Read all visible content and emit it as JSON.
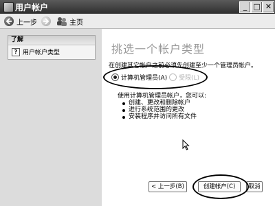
{
  "window": {
    "title": "用户帐户",
    "controls": {
      "minimize": "_",
      "maximize": "□",
      "close": "✕"
    }
  },
  "nav": {
    "back_label": "上一步",
    "home_label": "主页"
  },
  "sidebar": {
    "section_title": "了解",
    "items": [
      {
        "label": "用户帐户类型",
        "icon": "help-icon"
      }
    ]
  },
  "main": {
    "title": "挑选一个帐户类型",
    "instruction": "在创建其它帐户之前必须先创建至少一个管理员帐户。",
    "options": [
      {
        "label": "计算机管理员(A)",
        "selected": true,
        "enabled": true
      },
      {
        "label": "受限(L)",
        "selected": false,
        "enabled": false
      }
    ],
    "description_title": "使用计算机管理员帐户，您可以:",
    "description_items": [
      "创建、更改和删除帐户",
      "进行系统范围的更改",
      "安装程序并访问所有文件"
    ]
  },
  "buttons": {
    "back": "< 上一步(B)",
    "create": "创建帐户(C)",
    "cancel": "取消"
  },
  "colors": {
    "titlebar": "#3a3a3a",
    "title_text": "#9a9a9a"
  }
}
